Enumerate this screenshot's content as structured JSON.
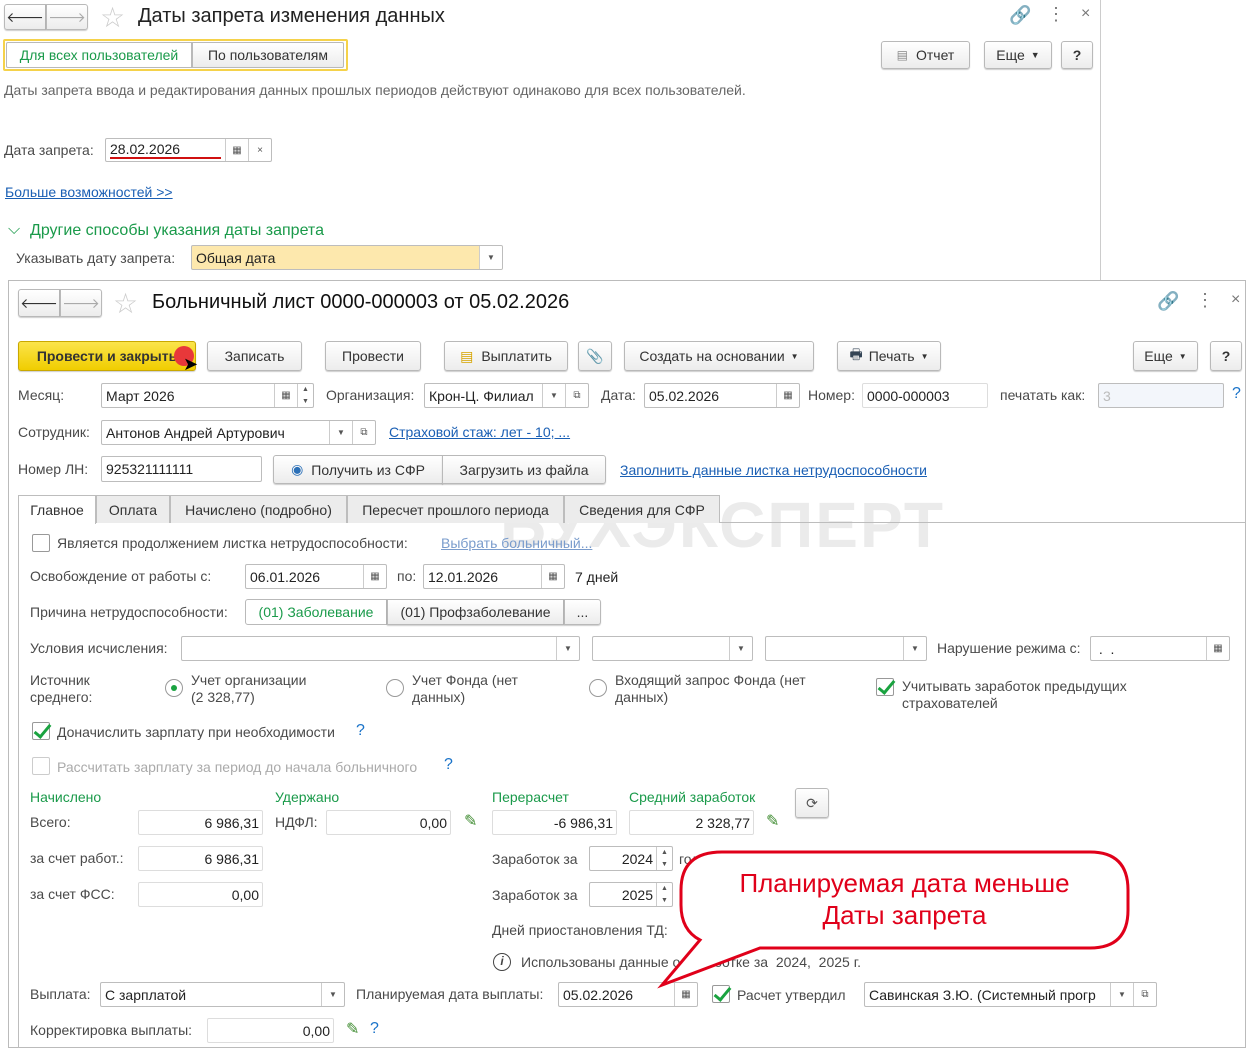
{
  "top_window": {
    "title": "Даты запрета изменения данных",
    "mode_tabs": [
      "Для всех пользователей",
      "По пользователям"
    ],
    "report_button": "Отчет",
    "more_button": "Еще",
    "help_button": "?",
    "description": "Даты запрета ввода и редактирования данных прошлых периодов действуют одинаково для всех пользователей.",
    "date_label": "Дата запрета:",
    "date_value": "28.02.2026",
    "more_link": "Больше возможностей >>",
    "section_title": "Другие способы указания даты запрета",
    "specify_label": "Указывать дату запрета:",
    "specify_value": "Общая дата"
  },
  "doc": {
    "title": "Больничный лист 0000-000003 от 05.02.2026",
    "toolbar": {
      "post_close": "Провести и закрыть",
      "save": "Записать",
      "post": "Провести",
      "pay": "Выплатить",
      "create_based": "Создать на основании",
      "print": "Печать",
      "more": "Еще",
      "help": "?"
    },
    "month_label": "Месяц:",
    "month_value": "Март 2026",
    "org_label": "Организация:",
    "org_value": "Крон-Ц. Филиал",
    "date_label": "Дата:",
    "date_value": "05.02.2026",
    "number_label": "Номер:",
    "number_value": "0000-000003",
    "print_as_label": "печатать как:",
    "print_as_value": "3",
    "employee_label": "Сотрудник:",
    "employee_value": "Антонов Андрей Артурович",
    "insurance_link": "Страховой стаж: лет - 10; ...",
    "ln_label": "Номер ЛН:",
    "ln_value": "925321111111",
    "get_sfr": "Получить из СФР",
    "load_file": "Загрузить из файла",
    "fill_link": "Заполнить данные листка нетрудоспособности",
    "tabs": [
      "Главное",
      "Оплата",
      "Начислено (подробно)",
      "Пересчет прошлого периода",
      "Сведения для СФР"
    ],
    "watermark": "БУХЭКСПЕРТ",
    "main": {
      "continuation_label": "Является продолжением листка нетрудоспособности:",
      "choose_link": "Выбрать больничный...",
      "release_label": "Освобождение от работы с:",
      "release_from": "06.01.2026",
      "to_label": "по:",
      "release_to": "12.01.2026",
      "days": "7 дней",
      "reason_label": "Причина нетрудоспособности:",
      "reason_options": [
        "(01) Заболевание",
        "(01) Профзаболевание",
        "..."
      ],
      "conditions_label": "Условия исчисления:",
      "violation_label": "Нарушение режима с:",
      "violation_value": " .  .",
      "source_label": "Источник\nсреднего:",
      "source_options": [
        "Учет организации\n(2 328,77)",
        "Учет Фонда (нет\nданных)",
        "Входящий запрос Фонда (нет\nданных)"
      ],
      "prev_employers": "Учитывать заработок предыдущих\nстрахователей",
      "accrue_label": "Доначислить зарплату при необходимости",
      "calc_label": "Рассчитать зарплату за период до начала больничного",
      "accrued_header": "Начислено",
      "withheld_header": "Удержано",
      "recalc_header": "Перерасчет",
      "avg_header": "Средний заработок",
      "total_label": "Всего:",
      "total_value": "6 986,31",
      "ndfl_label": "НДФЛ:",
      "ndfl_value": "0,00",
      "recalc_value": "-6 986,31",
      "avg_value": "2 328,77",
      "employer_label": "за счет работ.:",
      "employer_value": "6 986,31",
      "fss_label": "за счет ФСС:",
      "fss_value": "0,00",
      "earnings_label": "Заработок за",
      "year1": "2024",
      "year2": "2025",
      "year_suffix": "год",
      "suspension_label": "Дней приостановления ТД:",
      "info_text": "Использованы данные о заработке за  2024,  2025 г.",
      "payment_label": "Выплата:",
      "payment_value": "С зарплатой",
      "planned_label": "Планируемая дата выплаты:",
      "planned_value": "05.02.2026",
      "approved_label": "Расчет утвердил",
      "approved_value": "Савинская З.Ю. (Системный прогр",
      "correction_label": "Корректировка выплаты:",
      "correction_value": "0,00"
    }
  },
  "callout": {
    "line1": "Планируемая дата меньше",
    "line2": "Даты запрета",
    "color": "#e0001a"
  }
}
